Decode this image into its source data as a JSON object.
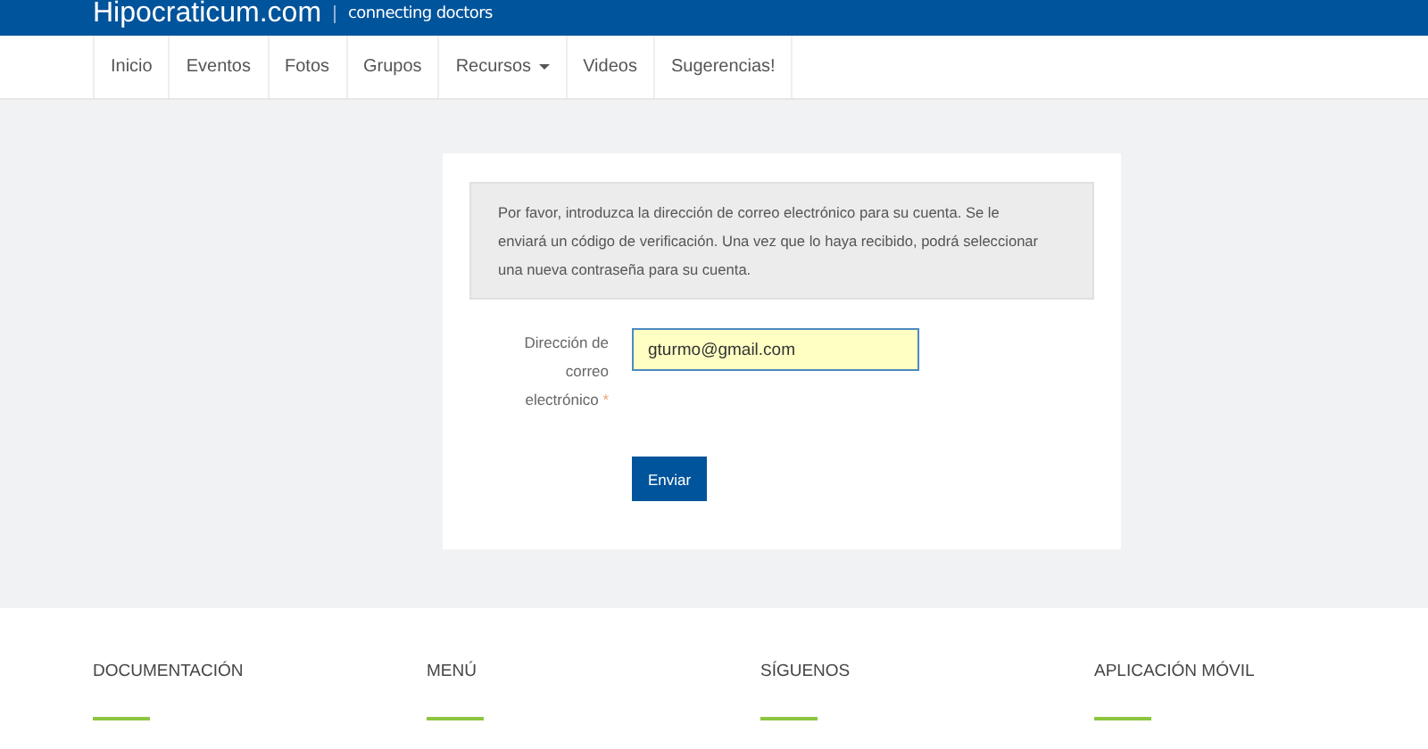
{
  "header": {
    "logo": "Hipocraticum.com",
    "tagline": "connecting doctors"
  },
  "nav": [
    {
      "label": "Inicio",
      "has_menu": false
    },
    {
      "label": "Eventos",
      "has_menu": false
    },
    {
      "label": "Fotos",
      "has_menu": false
    },
    {
      "label": "Grupos",
      "has_menu": false
    },
    {
      "label": "Recursos",
      "has_menu": true
    },
    {
      "label": "Videos",
      "has_menu": false
    },
    {
      "label": "Sugerencias!",
      "has_menu": false
    }
  ],
  "form": {
    "notice": "Por favor, introduzca la dirección de correo electrónico para su cuenta. Se le enviará un código de verificación. Una vez que lo haya recibido, podrá seleccionar una nueva contraseña para su cuenta.",
    "field_label": "Dirección de correo electrónico",
    "required_mark": "*",
    "email_value": "gturmo@gmail.com",
    "submit": "Enviar"
  },
  "footer": {
    "headings": [
      "DOCUMENTACIÓN",
      "MENÚ",
      "SÍGUENOS",
      "APLICACIÓN MÓVIL"
    ]
  }
}
